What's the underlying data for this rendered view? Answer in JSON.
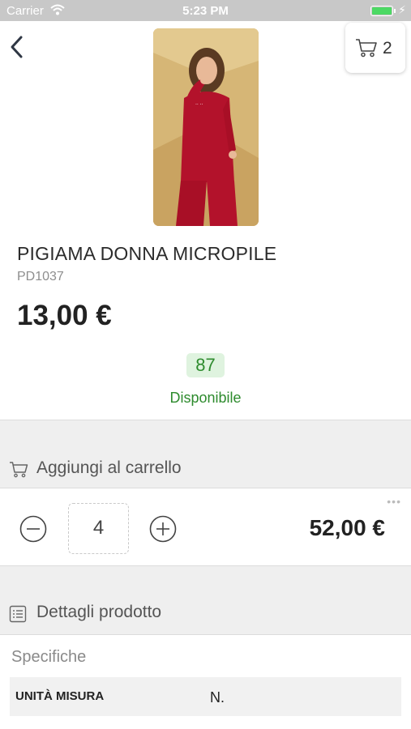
{
  "status_bar": {
    "carrier": "Carrier",
    "time": "5:23 PM"
  },
  "header": {
    "back_icon": "chevron-left-icon",
    "cart_icon": "shopping-cart-icon",
    "cart_count": "2"
  },
  "product": {
    "image_alt": "woman-in-red-pajamas",
    "title": "PIGIAMA DONNA MICROPILE",
    "code": "PD1037",
    "price": "13,00 €",
    "stock_count": "87",
    "stock_status": "Disponibile"
  },
  "add_to_cart": {
    "label": "Aggiungi al carrello",
    "icon": "shopping-cart-icon",
    "quantity": "4",
    "total": "52,00 €",
    "minus_icon": "minus-circle-icon",
    "plus_icon": "plus-circle-icon",
    "more_icon": "ellipsis-icon"
  },
  "details": {
    "label": "Dettagli prodotto",
    "icon": "list-icon",
    "specs_title": "Specifiche",
    "specs": [
      {
        "key": "UNITÀ MISURA",
        "value": "N."
      }
    ]
  },
  "colors": {
    "accent_green": "#2e8b2e",
    "badge_bg": "#dff3df",
    "status_bar_bg": "#c8c8c8",
    "section_bg": "#efefef"
  }
}
